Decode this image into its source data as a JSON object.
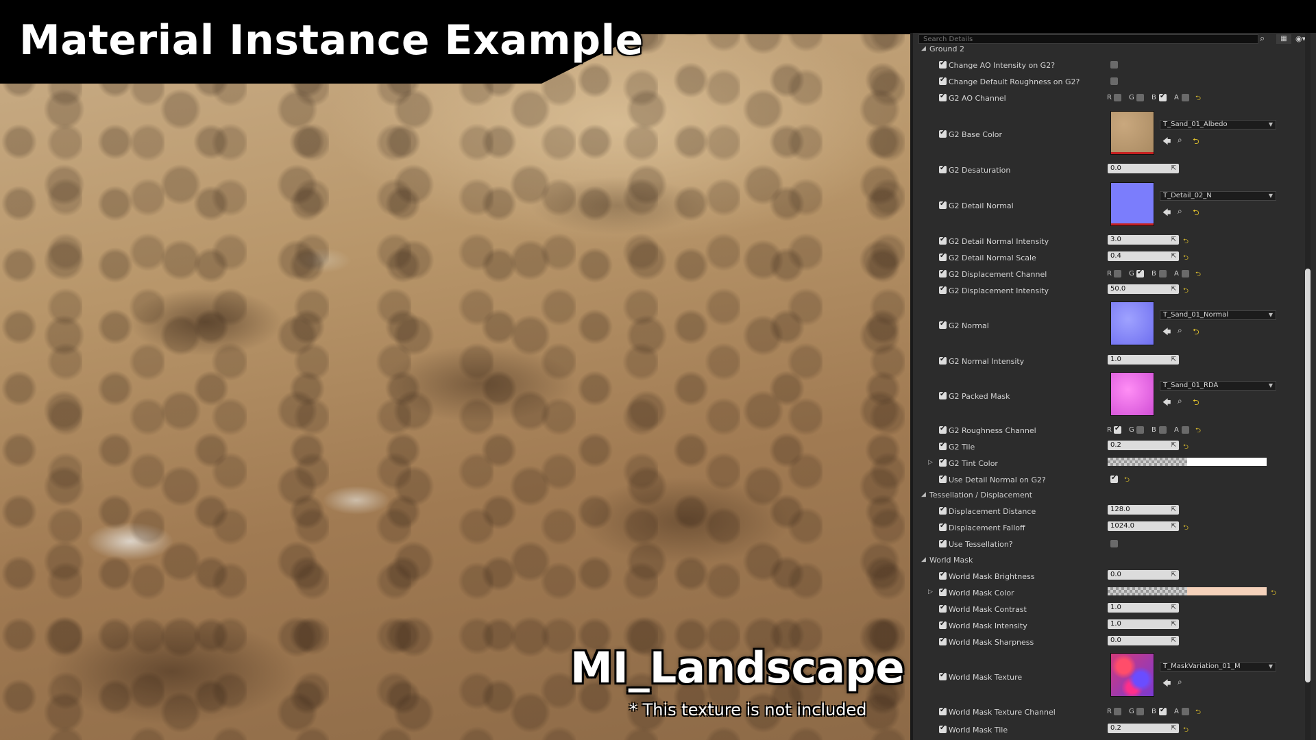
{
  "viewport": {
    "title": "Material Instance Example",
    "instance_name": "MI_Landscape",
    "texture_note": "* This texture is not included"
  },
  "details": {
    "search_placeholder": "Search Details",
    "icons": {
      "search": "search-icon",
      "view": "grid-view-icon",
      "visibility": "eye-icon"
    },
    "sections": {
      "ground2": "Ground 2",
      "tessellation": "Tessellation / Displacement",
      "world_mask": "World Mask"
    },
    "params": {
      "change_ao": "Change AO Intensity on G2?",
      "change_roughness": "Change Default Roughness on G2?",
      "g2_ao_channel": "G2 AO Channel",
      "g2_base_color": "G2 Base Color",
      "g2_base_color_asset": "T_Sand_01_Albedo",
      "g2_desaturation": "G2 Desaturation",
      "g2_desaturation_val": "0.0",
      "g2_detail_normal": "G2 Detail Normal",
      "g2_detail_normal_asset": "T_Detail_02_N",
      "g2_detail_normal_intensity": "G2 Detail Normal Intensity",
      "g2_detail_normal_intensity_val": "3.0",
      "g2_detail_normal_scale": "G2 Detail Normal Scale",
      "g2_detail_normal_scale_val": "0.4",
      "g2_displacement_channel": "G2 Displacement Channel",
      "g2_displacement_intensity": "G2 Displacement Intensity",
      "g2_displacement_intensity_val": "50.0",
      "g2_normal": "G2 Normal",
      "g2_normal_asset": "T_Sand_01_Normal",
      "g2_normal_intensity": "G2 Normal Intensity",
      "g2_normal_intensity_val": "1.0",
      "g2_packed_mask": "G2 Packed Mask",
      "g2_packed_mask_asset": "T_Sand_01_RDA",
      "g2_roughness_channel": "G2 Roughness Channel",
      "g2_tile": "G2 Tile",
      "g2_tile_val": "0.2",
      "g2_tint_color": "G2 Tint Color",
      "use_detail_normal": "Use Detail Normal on G2?",
      "displacement_distance": "Displacement Distance",
      "displacement_distance_val": "128.0",
      "displacement_falloff": "Displacement Falloff",
      "displacement_falloff_val": "1024.0",
      "use_tessellation": "Use Tessellation?",
      "wm_brightness": "World Mask Brightness",
      "wm_brightness_val": "0.0",
      "wm_color": "World Mask Color",
      "wm_contrast": "World Mask Contrast",
      "wm_contrast_val": "1.0",
      "wm_intensity": "World Mask Intensity",
      "wm_intensity_val": "1.0",
      "wm_sharpness": "World Mask Sharpness",
      "wm_sharpness_val": "0.0",
      "wm_texture": "World Mask Texture",
      "wm_texture_asset": "T_MaskVariation_01_M",
      "wm_texture_channel": "World Mask Texture Channel",
      "wm_tile": "World Mask Tile",
      "wm_tile_val": "0.2"
    },
    "channel_letters": {
      "r": "R",
      "g": "G",
      "b": "B",
      "a": "A"
    },
    "colors": {
      "g2_tint_solid": "#ffffff",
      "wm_color_solid": "#f5d2bb",
      "reset_arrow": "#e6c62c"
    }
  }
}
